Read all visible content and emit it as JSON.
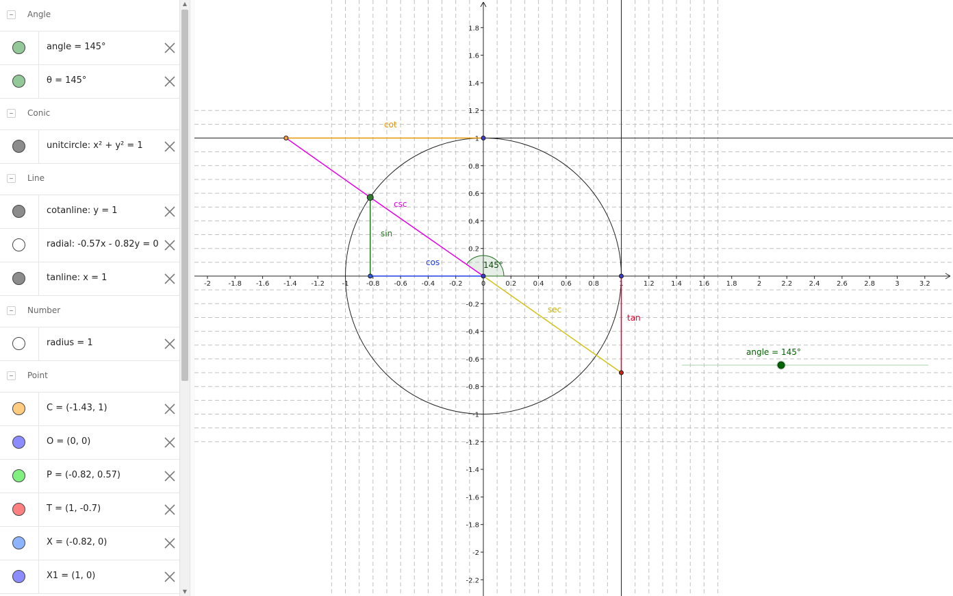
{
  "algebra": {
    "groups": [
      {
        "label": "Angle",
        "items": [
          {
            "text": "angle = 145°",
            "color": "#93c998"
          },
          {
            "text": "θ = 145°",
            "color": "#93c998"
          }
        ]
      },
      {
        "label": "Conic",
        "items": [
          {
            "text": "unitcircle: x² + y² = 1",
            "color": "#8c8c8c"
          }
        ]
      },
      {
        "label": "Line",
        "items": [
          {
            "text": "cotanline: y = 1",
            "color": "#8c8c8c"
          },
          {
            "text": "radial: -0.57x - 0.82y = 0",
            "color": "#ffffff"
          },
          {
            "text": "tanline: x = 1",
            "color": "#8c8c8c"
          }
        ]
      },
      {
        "label": "Number",
        "items": [
          {
            "text": "radius = 1",
            "color": "#ffffff"
          }
        ]
      },
      {
        "label": "Point",
        "items": [
          {
            "text": "C = (-1.43, 1)",
            "color": "#ffcc80"
          },
          {
            "text": "O = (0, 0)",
            "color": "#8c8cff"
          },
          {
            "text": "P = (-0.82, 0.57)",
            "color": "#80f080"
          },
          {
            "text": "T = (1, -0.7)",
            "color": "#ff8080"
          },
          {
            "text": "X = (-0.82, 0)",
            "color": "#8cb4ff"
          },
          {
            "text": "X1 = (1, 0)",
            "color": "#8c8cff"
          }
        ]
      }
    ]
  },
  "graphics": {
    "x_ticks": [
      "-2",
      "-1.8",
      "-1.6",
      "-1.4",
      "-1.2",
      "-1",
      "-0.8",
      "-0.6",
      "-0.4",
      "-0.2",
      "0",
      "0.2",
      "0.4",
      "0.6",
      "0.8",
      "1",
      "1.2",
      "1.4",
      "1.6",
      "1.8",
      "2",
      "2.2",
      "2.4",
      "2.6",
      "2.8",
      "3",
      "3.2"
    ],
    "y_ticks": [
      "1.8",
      "1.6",
      "1.4",
      "1.2",
      "1",
      "0.8",
      "0.6",
      "0.4",
      "0.2",
      "-0.2",
      "-0.4",
      "-0.6",
      "-0.8",
      "-1",
      "-1.2",
      "-1.4",
      "-1.6",
      "-1.8",
      "-2",
      "-2.2"
    ],
    "labels": {
      "cot": "cot",
      "csc": "csc",
      "sin": "sin",
      "cos": "cos",
      "sec": "sec",
      "tan": "tan",
      "angle_arc": "145°",
      "slider": "angle = 145°"
    },
    "angle_deg": 145,
    "points": {
      "O": [
        0,
        0
      ],
      "P": [
        -0.82,
        0.57
      ],
      "X": [
        -0.82,
        0
      ],
      "C": [
        -1.43,
        1
      ],
      "T": [
        1,
        -0.7
      ],
      "X1": [
        1,
        0
      ],
      "top": [
        0,
        1
      ]
    },
    "colors": {
      "cot": "#e69500",
      "csc": "#e600e6",
      "sin": "#1e7a1e",
      "cos": "#1f3fe6",
      "sec": "#d4c21a",
      "tan": "#e0002a",
      "slider": "#006400"
    }
  }
}
